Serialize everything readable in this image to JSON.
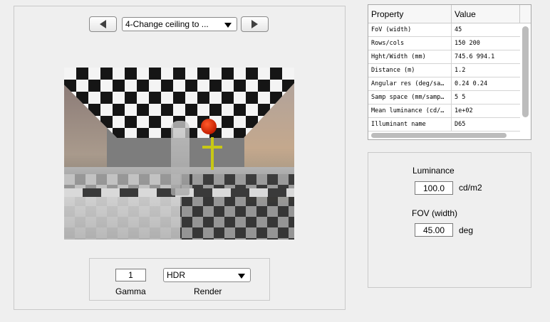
{
  "scene_selector": {
    "prev_icon": "left-triangle-icon",
    "selected": "4-Change ceiling to ...",
    "next_icon": "right-triangle-icon"
  },
  "display_controls": {
    "gamma_value": "1",
    "gamma_label": "Gamma",
    "render_selected": "HDR",
    "render_label": "Render"
  },
  "properties": {
    "header": {
      "property": "Property",
      "value": "Value"
    },
    "rows": [
      {
        "property": "FoV (width)",
        "value": "45"
      },
      {
        "property": "Rows/cols",
        "value": "150  200"
      },
      {
        "property": "Hght/Width (mm)",
        "value": "745.6  994.1"
      },
      {
        "property": "Distance (m)",
        "value": "1.2"
      },
      {
        "property": "Angular res (deg/sa…",
        "value": "0.24  0.24"
      },
      {
        "property": "Samp space (mm/samp…",
        "value": "5  5"
      },
      {
        "property": "Mean luminance (cd/…",
        "value": "1e+02"
      },
      {
        "property": "Illuminant name",
        "value": "D65"
      }
    ]
  },
  "edit_panel": {
    "luminance_label": "Luminance",
    "luminance_value": "100.0",
    "luminance_unit": "cd/m2",
    "fov_label": "FOV (width)",
    "fov_value": "45.00",
    "fov_unit": "deg"
  }
}
